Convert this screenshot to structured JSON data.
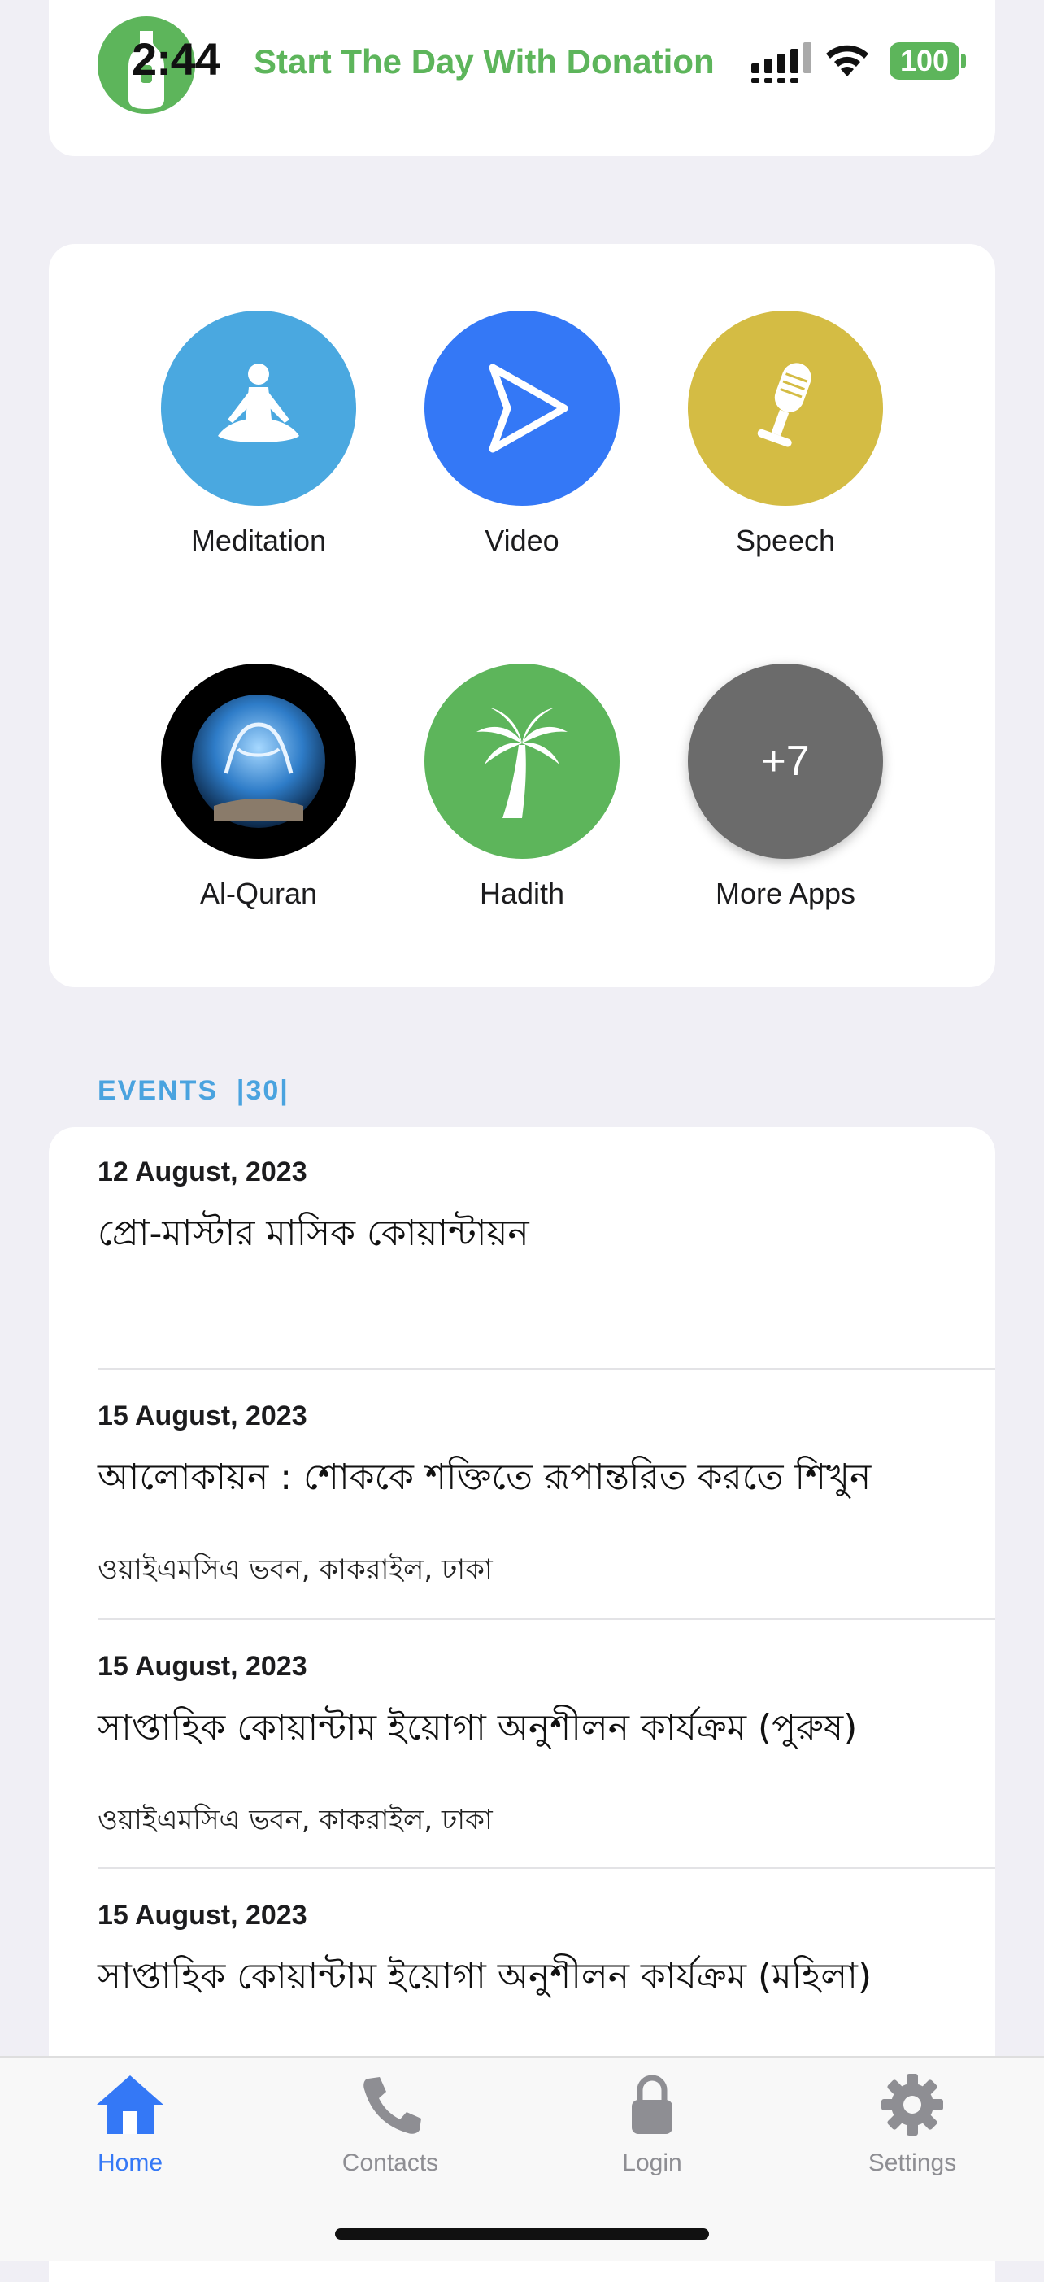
{
  "status_bar": {
    "time": "2:44",
    "battery": "100"
  },
  "banner": {
    "text": "Start The Day With Donation"
  },
  "apps": [
    {
      "label": "Meditation",
      "icon": "meditation-icon",
      "color": "#4aa8e0"
    },
    {
      "label": "Video",
      "icon": "play-icon",
      "color": "#3478f6"
    },
    {
      "label": "Speech",
      "icon": "microphone-icon",
      "color": "#d4bc44"
    },
    {
      "label": "Al-Quran",
      "icon": "quran-icon",
      "color": "#000000"
    },
    {
      "label": "Hadith",
      "icon": "palm-tree-icon",
      "color": "#5db55b"
    },
    {
      "label": "More Apps",
      "icon": "plus-count",
      "badge": "+7",
      "color": "#6b6b6b"
    }
  ],
  "events": {
    "header": "EVENTS  |30|",
    "items": [
      {
        "date": "12 August, 2023",
        "title": "প্রো-মাস্টার মাসিক কোয়ান্টায়ন",
        "location": ""
      },
      {
        "date": "15 August, 2023",
        "title": "আলোকায়ন : শোককে শক্তিতে রূপান্তরিত করতে শিখুন",
        "location": "ওয়াইএমসিএ ভবন, কাকরাইল, ঢাকা"
      },
      {
        "date": "15 August, 2023",
        "title": "সাপ্তাহিক কোয়ান্টাম ইয়োগা অনুশীলন কার্যক্রম (পুরুষ)",
        "location": "ওয়াইএমসিএ ভবন, কাকরাইল, ঢাকা"
      },
      {
        "date": "15 August, 2023",
        "title": "সাপ্তাহিক কোয়ান্টাম ইয়োগা অনুশীলন কার্যক্রম (মহিলা)",
        "location": ""
      }
    ]
  },
  "tabbar": {
    "active": "Home",
    "tabs": [
      {
        "label": "Home",
        "icon": "home-icon"
      },
      {
        "label": "Contacts",
        "icon": "phone-icon"
      },
      {
        "label": "Login",
        "icon": "lock-icon"
      },
      {
        "label": "Settings",
        "icon": "gear-icon"
      }
    ],
    "active_color": "#3478f6",
    "inactive_color": "#8e8e93"
  }
}
